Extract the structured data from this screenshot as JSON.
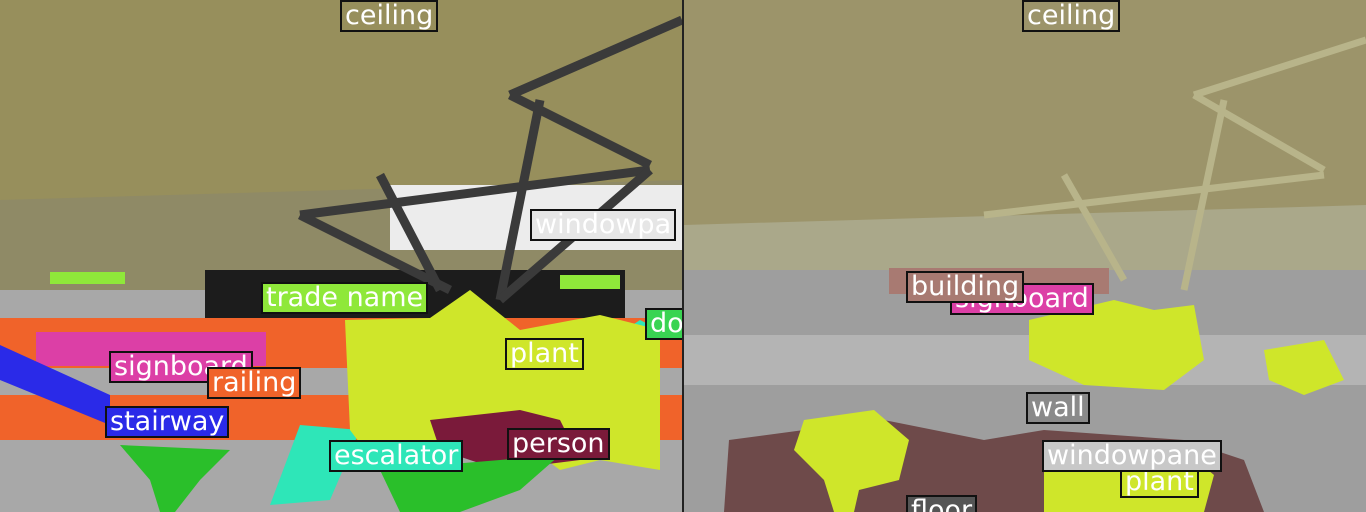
{
  "left_labels": {
    "ceiling": "ceiling",
    "windowpane": "windowpa",
    "trade_name": "trade name",
    "door": "do",
    "plant": "plant",
    "signboard": "signboard",
    "railing": "railing",
    "stairway": "stairway",
    "escalator": "escalator",
    "person": "person"
  },
  "right_labels": {
    "ceiling": "ceiling",
    "building": "building",
    "signboard": "signboard",
    "wall": "wall",
    "windowpane": "windowpane",
    "plant": "plant",
    "floor": "floor"
  },
  "colors": {
    "ceiling": "#978f5c",
    "windowpane": "#e6e6e6",
    "trade_name": "#8fe83a",
    "plant": "#cfe62a",
    "signboard": "#dc3fa6",
    "railing": "#f0632a",
    "stairway": "#2a2ae8",
    "escalator": "#2ee6b8",
    "person": "#7a1a3a",
    "building": "#a87a72",
    "wall": "#8a8a8a",
    "floor": "#555555",
    "palm": "#2abf2a"
  }
}
